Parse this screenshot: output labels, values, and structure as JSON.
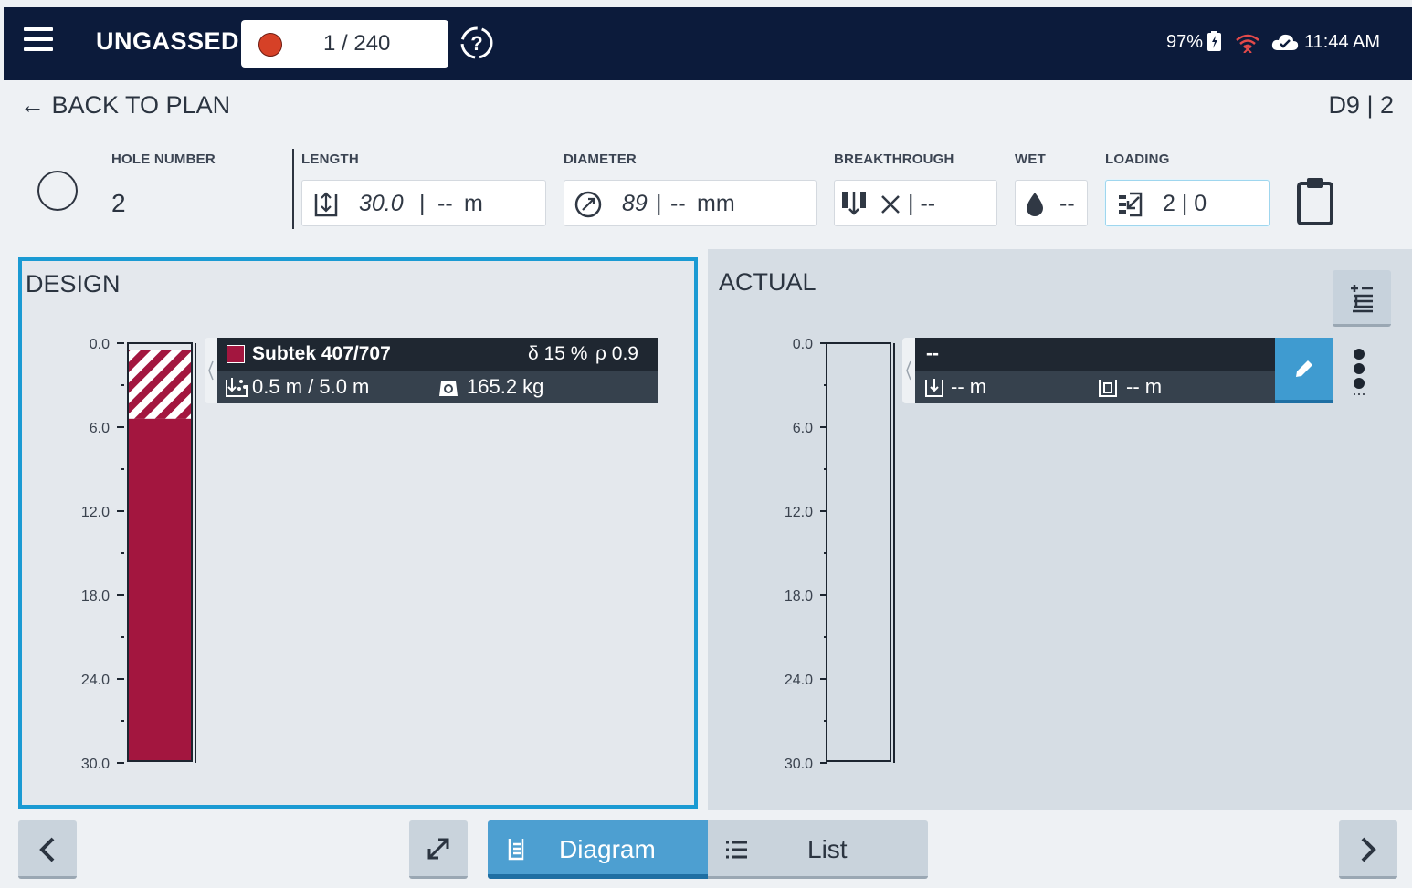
{
  "header": {
    "status_title": "UNGASSED",
    "counter": "1 / 240",
    "battery": "97%",
    "time": "11:44 AM",
    "icons": [
      "menu-icon",
      "help-icon",
      "battery-icon",
      "wifi-icon",
      "cloud-icon"
    ],
    "colors": {
      "bar": "#0c1b3b",
      "record_dot": "#d64127"
    }
  },
  "nav": {
    "back_label": "← BACK TO PLAN",
    "hole_id": "D9 | 2"
  },
  "fields": {
    "hole_number": {
      "label": "HOLE NUMBER",
      "value": "2"
    },
    "length": {
      "label": "LENGTH",
      "value": "30.0",
      "sep": "|",
      "actual": "--",
      "unit": "m"
    },
    "diameter": {
      "label": "DIAMETER",
      "value": "89",
      "sep": "|",
      "actual": "--",
      "unit": "mm"
    },
    "breakthrough": {
      "label": "BREAKTHROUGH",
      "value": "|  --"
    },
    "wet": {
      "label": "WET",
      "value": "--"
    },
    "loading": {
      "label": "LOADING",
      "value": "2 | 0"
    }
  },
  "design": {
    "title": "DESIGN",
    "depth_ticks": [
      "0.0",
      "6.0",
      "12.0",
      "18.0",
      "24.0",
      "30.0"
    ],
    "depth_range": [
      0,
      30
    ],
    "stemming_to": 5.0,
    "deck": {
      "product": "Subtek 407/707",
      "density_text": "δ 15 %",
      "rho_text": "ρ 0.9",
      "length_text": "0.5 m / 5.0 m",
      "weight_text": "165.2 kg",
      "color": "#a3163f"
    }
  },
  "actual": {
    "title": "ACTUAL",
    "depth_ticks": [
      "0.0",
      "6.0",
      "12.0",
      "18.0",
      "24.0",
      "30.0"
    ],
    "deck": {
      "product": "--",
      "top_text": "-- m",
      "bottom_text": "-- m"
    }
  },
  "bottom_bar": {
    "diagram_label": "Diagram",
    "list_label": "List",
    "icons": [
      "chevron-left-icon",
      "expand-icon",
      "diagram-icon",
      "list-icon",
      "chevron-right-icon"
    ]
  }
}
